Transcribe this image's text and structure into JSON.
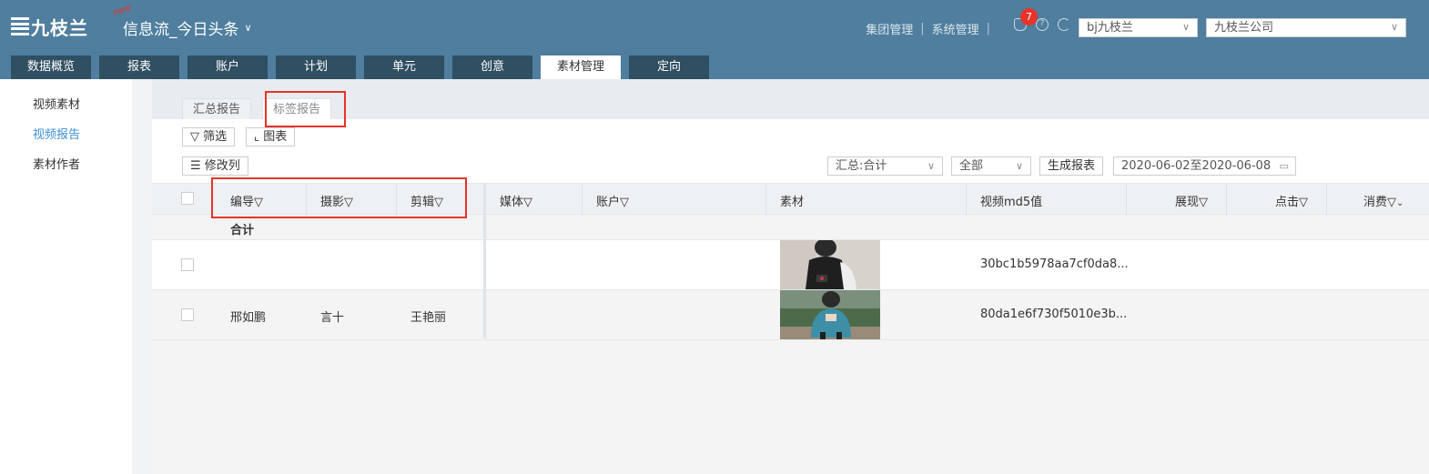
{
  "header": {
    "logo_text": "九枝兰",
    "new_tag": "new",
    "product": "信息流_今日头条",
    "links": [
      "集团管理",
      "系统管理"
    ],
    "notification_count": "7",
    "account_select": "bj九枝兰",
    "company_select": "九枝兰公司"
  },
  "nav": {
    "tabs": [
      "数据概览",
      "报表",
      "账户",
      "计划",
      "单元",
      "创意",
      "素材管理",
      "定向"
    ],
    "active": "素材管理"
  },
  "sidebar": {
    "items": [
      "视频素材",
      "视频报告",
      "素材作者"
    ],
    "active": "视频报告"
  },
  "subtabs": {
    "items": [
      "汇总报告",
      "标签报告"
    ],
    "active": "标签报告"
  },
  "toolbar": {
    "filter_label": "筛选",
    "chart_label": "图表",
    "modify_columns_label": "修改列",
    "summary_select": "汇总:合计",
    "scope_select": "全部",
    "generate_label": "生成报表",
    "date_range": "2020-06-02至2020-06-08"
  },
  "table": {
    "columns": [
      "编导",
      "摄影",
      "剪辑",
      "媒体",
      "账户",
      "素材",
      "视频md5值",
      "展现",
      "点击",
      "消费"
    ],
    "total_label": "合计",
    "rows": [
      {
        "director": "",
        "photographer": "",
        "editor": "",
        "md5": "30bc1b5978aa7cf0da8..."
      },
      {
        "director": "邢如鹏",
        "photographer": "言十",
        "editor": "王艳丽",
        "md5": "80da1e6f730f5010e3b..."
      }
    ]
  },
  "colors": {
    "header_bg": "#4f7e9e",
    "nav_tab_bg": "#2f4f62",
    "highlight_red": "#e8332a",
    "link_blue": "#3d8fd3"
  }
}
